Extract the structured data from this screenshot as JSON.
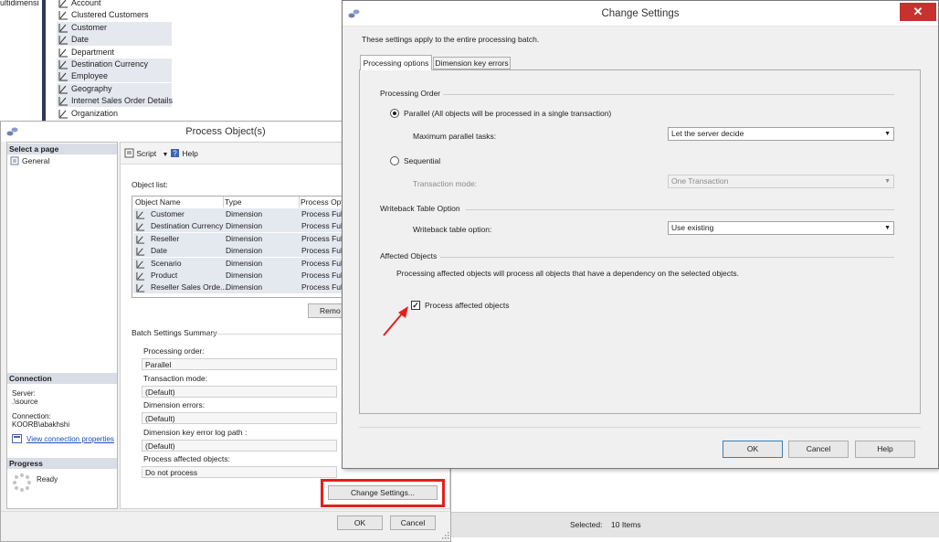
{
  "tree": {
    "items": [
      {
        "label": "Account",
        "selected": false
      },
      {
        "label": "Clustered Customers",
        "selected": false
      },
      {
        "label": "Customer",
        "selected": true
      },
      {
        "label": "Date",
        "selected": true
      },
      {
        "label": "Department",
        "selected": false
      },
      {
        "label": "Destination Currency",
        "selected": true
      },
      {
        "label": "Employee",
        "selected": true
      },
      {
        "label": "Geography",
        "selected": true
      },
      {
        "label": "Internet Sales Order Details",
        "selected": true
      },
      {
        "label": "Organization",
        "selected": false
      }
    ],
    "clipped_text": "ultidimensi"
  },
  "process_dialog": {
    "title": "Process Object(s)",
    "select_page": "Select a page",
    "pages": [
      "General"
    ],
    "toolbar": {
      "script": "Script",
      "help": "Help"
    },
    "object_list_label": "Object list:",
    "columns": [
      "Object Name",
      "Type",
      "Process Optio"
    ],
    "rows": [
      {
        "name": "Customer",
        "type": "Dimension",
        "option": "Process Full"
      },
      {
        "name": "Destination Currency",
        "type": "Dimension",
        "option": "Process Full"
      },
      {
        "name": "Reseller",
        "type": "Dimension",
        "option": "Process Full"
      },
      {
        "name": "Date",
        "type": "Dimension",
        "option": "Process Full"
      },
      {
        "name": "Scenario",
        "type": "Dimension",
        "option": "Process Full"
      },
      {
        "name": "Product",
        "type": "Dimension",
        "option": "Process Full"
      },
      {
        "name": "Reseller Sales Orde...",
        "type": "Dimension",
        "option": "Process Full"
      }
    ],
    "remove_button": "Remo",
    "batch_summary_label": "Batch Settings Summary",
    "summary": [
      {
        "label": "Processing order:",
        "value": "Parallel"
      },
      {
        "label": "Transaction mode:",
        "value": "(Default)"
      },
      {
        "label": "Dimension errors:",
        "value": "(Default)"
      },
      {
        "label": "Dimension key error log path :",
        "value": "(Default)"
      },
      {
        "label": "Process affected objects:",
        "value": "Do not process"
      }
    ],
    "change_settings_button": "Change Settings...",
    "connection_header": "Connection",
    "server_label": "Server:",
    "server_value": ".\\source",
    "connection_label": "Connection:",
    "connection_value": "KOORB\\abakhshi",
    "view_connection_link": "View connection properties",
    "progress_header": "Progress",
    "progress_status": "Ready",
    "ok_button": "OK",
    "cancel_button": "Cancel"
  },
  "change_settings": {
    "title": "Change Settings",
    "close_glyph": "✕",
    "intro": "These settings apply to the entire processing batch.",
    "tabs": [
      "Processing options",
      "Dimension key errors"
    ],
    "processing_order_header": "Processing Order",
    "parallel_label": "Parallel (All objects will be processed in a single transaction)",
    "max_parallel_label": "Maximum parallel tasks:",
    "max_parallel_value": "Let the server decide",
    "sequential_label": "Sequential",
    "transaction_mode_label": "Transaction mode:",
    "transaction_mode_value": "One Transaction",
    "writeback_header": "Writeback Table Option",
    "writeback_label": "Writeback table option:",
    "writeback_value": "Use existing",
    "affected_header": "Affected Objects",
    "affected_desc": "Processing affected objects will process all objects that have a dependency on the selected objects.",
    "process_affected_label": "Process affected objects",
    "process_affected_checked": true,
    "ok_button": "OK",
    "cancel_button": "Cancel",
    "help_button": "Help"
  },
  "status": {
    "selected_label": "Selected:",
    "selected_value": "10 Items"
  },
  "colors": {
    "highlight": "#e2201c",
    "titlebar_close": "#c7312e",
    "header_bg": "#d9dde6"
  }
}
